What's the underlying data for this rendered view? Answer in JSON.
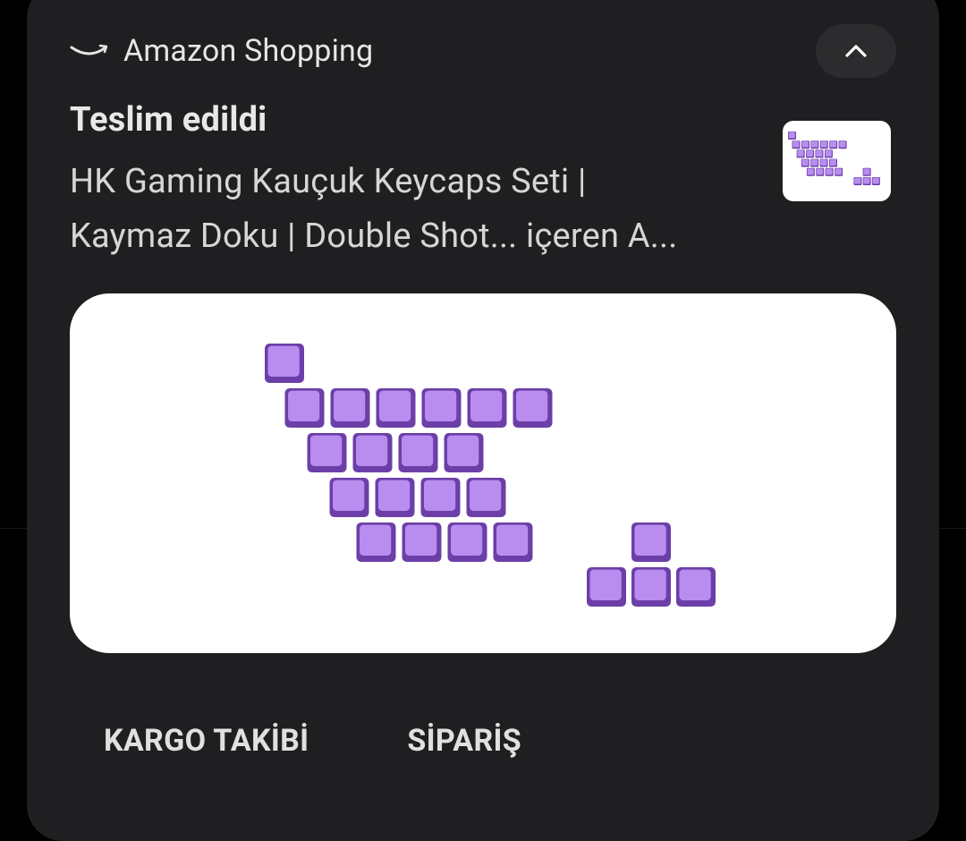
{
  "notification": {
    "app_name": "Amazon Shopping",
    "app_icon": "amazon-smile-icon",
    "expand_icon": "chevron-up-icon",
    "title": "Teslim edildi",
    "body_line1": "HK Gaming Kauçuk Keycaps Seti |",
    "body_line2": "Kaymaz Doku | Double Shot... içeren A...",
    "thumbnail": "keycaps-thumbnail-image",
    "image": "keycaps-product-image",
    "actions": [
      {
        "label": "KARGO TAKİBİ"
      },
      {
        "label": "SİPARİŞ"
      }
    ]
  },
  "colors": {
    "background": "#000000",
    "card": "#1f1f21",
    "button_bg": "#2c2c2e",
    "keycap_fill": "#b98df0",
    "keycap_edge": "#6c3fa8"
  }
}
